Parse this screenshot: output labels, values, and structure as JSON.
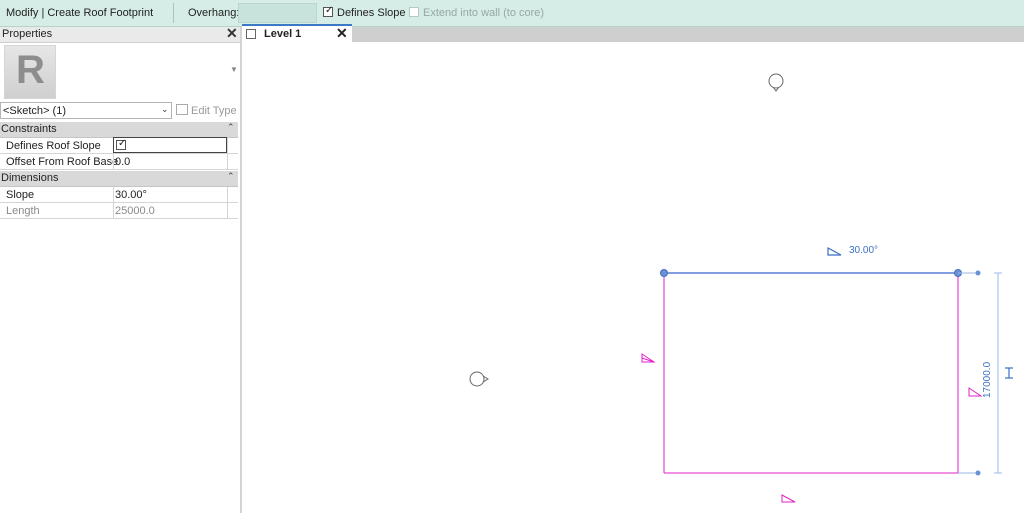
{
  "options_bar": {
    "context_label": "Modify | Create Roof Footprint",
    "overhang_label": "Overhang:",
    "overhang_value": "",
    "defines_slope_label": "Defines Slope",
    "defines_slope_checked": true,
    "extend_label": "Extend into wall (to core)",
    "extend_checked": false
  },
  "properties": {
    "title": "Properties",
    "type_selector": "<Sketch> (1)",
    "edit_type": "Edit Type",
    "sections": [
      {
        "name": "Constraints",
        "rows": [
          {
            "label": "Defines Roof Slope",
            "value": "",
            "checked": true
          },
          {
            "label": "Offset From Roof Base",
            "value": "0.0"
          }
        ]
      },
      {
        "name": "Dimensions",
        "rows": [
          {
            "label": "Slope",
            "value": "30.00°"
          },
          {
            "label": "Length",
            "value": "25000.0",
            "disabled": true
          }
        ]
      }
    ]
  },
  "view_tab": {
    "label": "Level 1"
  },
  "canvas": {
    "slope_label": "30.00°",
    "dimension_label": "17000.0",
    "colors": {
      "sketch": "#e020c8",
      "selected": "#5a7fd6",
      "dimension": "#5b8fd8",
      "accent": "#3c79c5"
    }
  }
}
